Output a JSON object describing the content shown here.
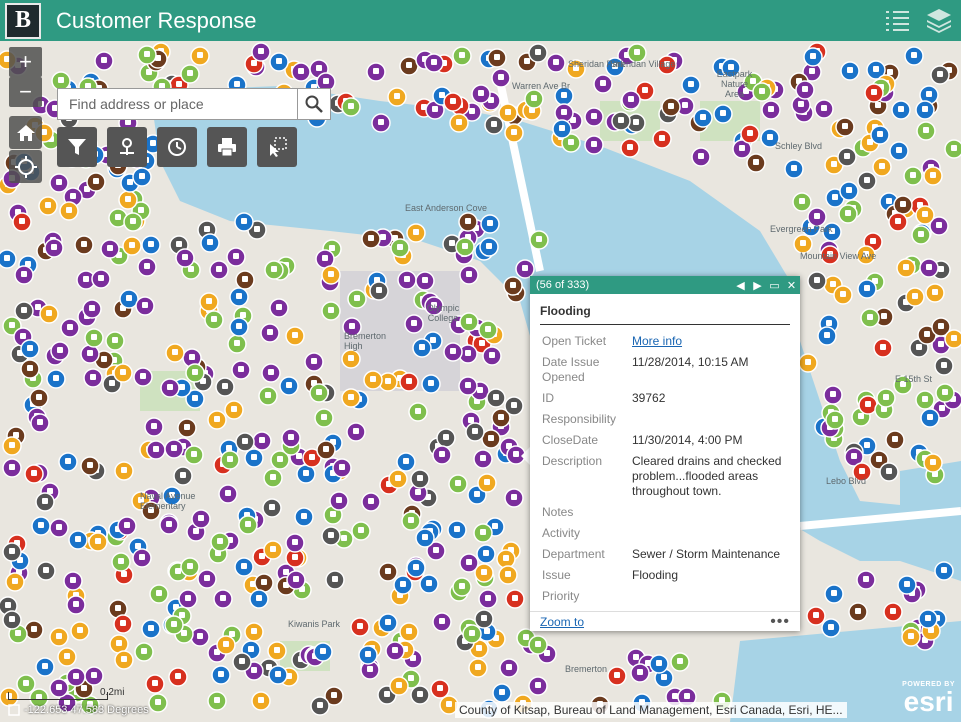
{
  "header": {
    "logo": "B",
    "title": "Customer Response",
    "icons": [
      "legend-list-icon",
      "layers-icon"
    ]
  },
  "search": {
    "placeholder": "Find address or place"
  },
  "zoom": {
    "in": "+",
    "out": "−"
  },
  "tools": [
    "filter-icon",
    "location-pin-icon",
    "history-icon",
    "print-icon",
    "select-icon"
  ],
  "map_labels": [
    "Sheridan Park",
    "Sheridan Village",
    "Eastpark Nature Area",
    "East Anderson Cove",
    "Olympic College",
    "Bremerton High",
    "Naval Avenue Elementary",
    "Kiwanis Park",
    "Evergreen Park",
    "E 15th St",
    "Bremerton",
    "Lebo Blvd",
    "Mountain View Ave",
    "Schley Blvd",
    "Warren Ave Br"
  ],
  "popup": {
    "counter": "(56 of 333)",
    "title": "Flooding",
    "fields": [
      {
        "key": "Open Ticket",
        "value": "More info",
        "link": true
      },
      {
        "key": "Date Issue Opened",
        "value": "11/28/2014, 10:15 AM"
      },
      {
        "key": "ID",
        "value": "39762"
      },
      {
        "key": "Responsibility",
        "value": ""
      },
      {
        "key": "CloseDate",
        "value": "11/30/2014, 4:00 PM"
      },
      {
        "key": "Description",
        "value": "Cleared drains and checked problem...flooded areas throughout town."
      },
      {
        "key": "Notes",
        "value": ""
      },
      {
        "key": "Activity",
        "value": ""
      },
      {
        "key": "Department",
        "value": "Sewer / Storm Maintenance"
      },
      {
        "key": "Issue",
        "value": "Flooding"
      },
      {
        "key": "Priority",
        "value": ""
      }
    ],
    "zoom_to": "Zoom to",
    "more": "•••"
  },
  "scale": "0.2mi",
  "coordinates": "-122.653 47.583 Degrees",
  "attribution": "County of Kitsap, Bureau of Land Management, Esri Canada, Esri, HE...",
  "esri": {
    "powered": "POWERED BY",
    "name": "esri"
  },
  "marker_colors": {
    "purple": "#7b2d9c",
    "blue": "#1a73c9",
    "green": "#7fbf4d",
    "orange": "#f0a820",
    "brown": "#6b3b1e",
    "red": "#d7301f",
    "gray": "#555555"
  }
}
